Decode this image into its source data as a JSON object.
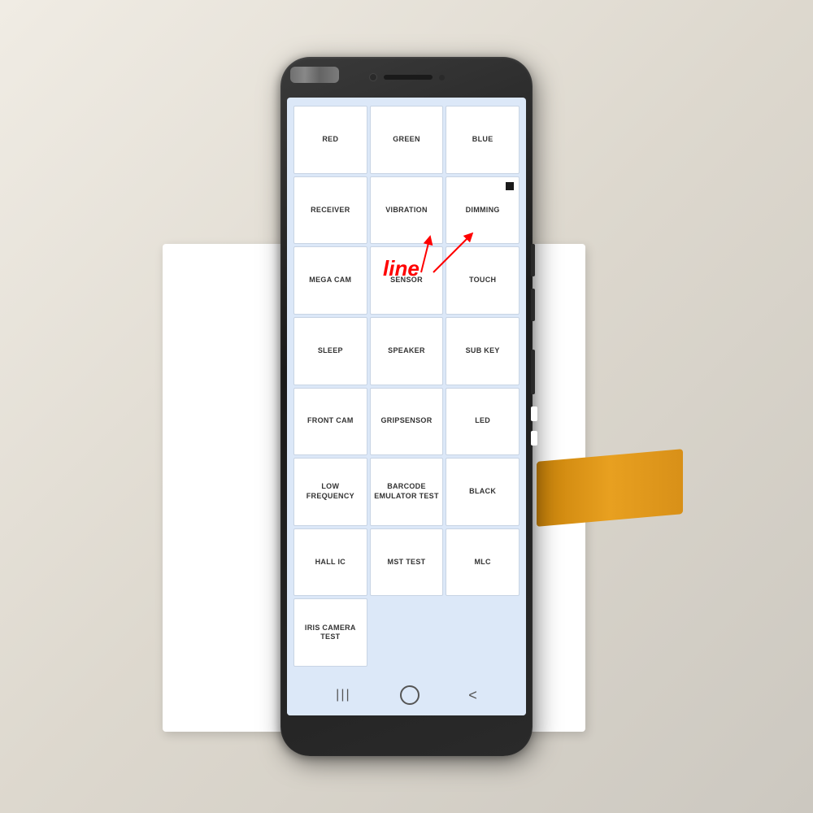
{
  "background": {
    "color": "#e8e4dc"
  },
  "phone": {
    "screen_bg": "#dce8f8",
    "nav_bar": {
      "recent_icon": "|||",
      "home_icon": "○",
      "back_icon": "<"
    },
    "grid_buttons": [
      {
        "id": "red",
        "label": "RED",
        "col": 1,
        "row": 1
      },
      {
        "id": "green",
        "label": "GREEN",
        "col": 2,
        "row": 1
      },
      {
        "id": "blue",
        "label": "BLUE",
        "col": 3,
        "row": 1
      },
      {
        "id": "receiver",
        "label": "RECEIVER",
        "col": 1,
        "row": 2
      },
      {
        "id": "vibration",
        "label": "VIBRATION",
        "col": 2,
        "row": 2
      },
      {
        "id": "dimming",
        "label": "DIMMING",
        "col": 3,
        "row": 2
      },
      {
        "id": "mega-cam",
        "label": "MEGA CAM",
        "col": 1,
        "row": 3
      },
      {
        "id": "sensor",
        "label": "SENSOR",
        "col": 2,
        "row": 3
      },
      {
        "id": "touch",
        "label": "TOUCH",
        "col": 3,
        "row": 3
      },
      {
        "id": "sleep",
        "label": "SLEEP",
        "col": 1,
        "row": 4
      },
      {
        "id": "speaker",
        "label": "SPEAKER",
        "col": 2,
        "row": 4
      },
      {
        "id": "sub-key",
        "label": "SUB KEY",
        "col": 3,
        "row": 4
      },
      {
        "id": "front-cam",
        "label": "FRONT CAM",
        "col": 1,
        "row": 5
      },
      {
        "id": "gripsensor",
        "label": "GRIPSENSOR",
        "col": 2,
        "row": 5
      },
      {
        "id": "led",
        "label": "LED",
        "col": 3,
        "row": 5
      },
      {
        "id": "low-frequency",
        "label": "LOW FREQUENCY",
        "col": 1,
        "row": 6
      },
      {
        "id": "barcode-emulator",
        "label": "BARCODE\nEMULATOR TEST",
        "col": 2,
        "row": 6
      },
      {
        "id": "black",
        "label": "BLACK",
        "col": 3,
        "row": 6
      },
      {
        "id": "hall-ic",
        "label": "HALL IC",
        "col": 1,
        "row": 7
      },
      {
        "id": "mst-test",
        "label": "MST TEST",
        "col": 2,
        "row": 7
      },
      {
        "id": "mlc",
        "label": "MLC",
        "col": 3,
        "row": 7
      },
      {
        "id": "iris-camera",
        "label": "IRIS CAMERA\nTEST",
        "col": 1,
        "row": 8
      }
    ],
    "annotation": {
      "word": "line",
      "color": "red"
    }
  }
}
